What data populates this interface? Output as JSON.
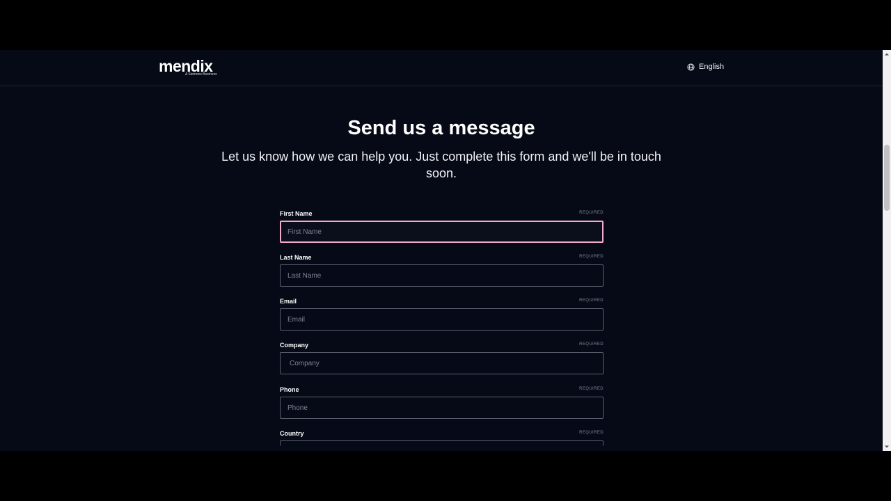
{
  "header": {
    "logo_text": "mendix",
    "logo_tagline": "A Siemens Business",
    "language_label": "English",
    "language_icon": "globe-icon"
  },
  "main": {
    "title": "Send us a message",
    "subtitle": "Let us know how we can help you. Just complete this form and we'll be in touch soon."
  },
  "form": {
    "fields": [
      {
        "label": "First Name",
        "required_text": "REQUIRED",
        "placeholder": "First Name",
        "value": "",
        "focused": true
      },
      {
        "label": "Last Name",
        "required_text": "REQUIRED",
        "placeholder": "Last Name",
        "value": ""
      },
      {
        "label": "Email",
        "required_text": "REQUIRED",
        "placeholder": "Email",
        "value": ""
      },
      {
        "label": "Company",
        "required_text": "REQUIRED",
        "placeholder": "Company",
        "value": ""
      },
      {
        "label": "Phone",
        "required_text": "REQUIRED",
        "placeholder": "Phone",
        "value": ""
      },
      {
        "label": "Country",
        "required_text": "REQUIRED",
        "placeholder": "",
        "value": ""
      }
    ]
  },
  "colors": {
    "page_background": "#060a16",
    "focus_border": "#f3a9c8",
    "input_border": "#5b6070",
    "muted_text": "#7d8295"
  }
}
